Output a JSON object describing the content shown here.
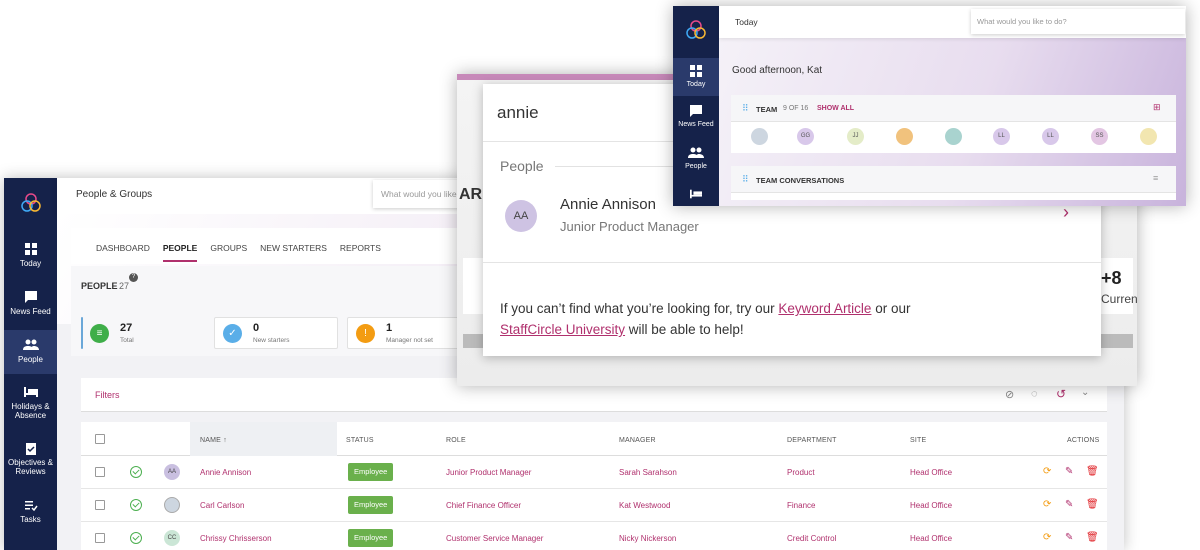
{
  "people_window": {
    "sidebar": {
      "items": [
        {
          "label": "Today",
          "icon": "grid-icon"
        },
        {
          "label": "News Feed",
          "icon": "chat-icon"
        },
        {
          "label": "People",
          "icon": "people-icon"
        },
        {
          "label": "Holidays & Absence",
          "icon": "bed-icon"
        },
        {
          "label": "Objectives & Reviews",
          "icon": "clipboard-check-icon"
        },
        {
          "label": "Tasks",
          "icon": "task-list-icon"
        }
      ]
    },
    "header_title": "People & Groups",
    "search_placeholder": "What would you like to do?",
    "tabs": [
      "DASHBOARD",
      "PEOPLE",
      "GROUPS",
      "NEW STARTERS",
      "REPORTS"
    ],
    "active_tab": "PEOPLE",
    "section_title": "PEOPLE",
    "section_count": "27",
    "help_icon": "?",
    "stat_cards": [
      {
        "value": "27",
        "label": "Total",
        "color": "#3fae49",
        "icon": "list-icon"
      },
      {
        "value": "0",
        "label": "New starters",
        "color": "#5aaee8",
        "icon": "check-icon"
      },
      {
        "value": "1",
        "label": "Manager not set",
        "color": "#f39c12",
        "icon": "warning-icon"
      }
    ],
    "filters_label": "Filters",
    "columns": [
      "NAME",
      "STATUS",
      "ROLE",
      "MANAGER",
      "DEPARTMENT",
      "SITE",
      "ACTIONS"
    ],
    "rows": [
      {
        "initials": "AA",
        "name": "Annie Annison",
        "status": "Employee",
        "role": "Junior Product Manager",
        "manager": "Sarah Sarahson",
        "department": "Product",
        "site": "Head Office"
      },
      {
        "initials": "",
        "name": "Carl Carlson",
        "status": "Employee",
        "role": "Chief Finance Officer",
        "manager": "Kat Westwood",
        "department": "Finance",
        "site": "Head Office"
      },
      {
        "initials": "CC",
        "name": "Chrissy Chrisserson",
        "status": "Employee",
        "role": "Customer Service Manager",
        "manager": "Nicky Nickerson",
        "department": "Credit Control",
        "site": "Head Office"
      }
    ]
  },
  "search_window": {
    "query": "annie",
    "section_label": "People",
    "result": {
      "initials": "AA",
      "name": "Annie Annison",
      "role": "Junior Product Manager"
    },
    "help_prefix": "If you can’t find what you’re looking for, try our ",
    "help_link1": "Keyword Article",
    "help_middle": " or our",
    "help_link2": "StaffCircle University",
    "help_suffix": " will be able to help!",
    "bg_fragment_title": "ARI",
    "bg_fragment_stat": "+8",
    "bg_fragment_stat_label": "Curren"
  },
  "today_window": {
    "sidebar": [
      {
        "label": "Today",
        "icon": "grid-icon"
      },
      {
        "label": "News Feed",
        "icon": "chat-icon"
      },
      {
        "label": "People",
        "icon": "people-icon"
      }
    ],
    "header_title": "Today",
    "search_placeholder": "What would you like to do?",
    "greeting": "Good afternoon, Kat",
    "team_title": "TEAM",
    "team_count": "9 OF 16",
    "show_all": "SHOW ALL",
    "team_members": [
      "",
      "GG",
      "JJ",
      "",
      "",
      "LL",
      "LL",
      "SS",
      ""
    ],
    "conversations_title": "TEAM CONVERSATIONS"
  }
}
